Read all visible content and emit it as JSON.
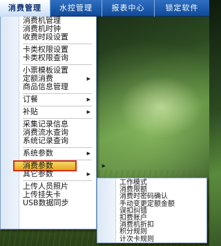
{
  "topbar": {
    "items": [
      "消费管理",
      "水控管理",
      "报表中心",
      "锁定软件"
    ]
  },
  "menu": {
    "group1": [
      "消费机管理",
      "消费机时钟",
      "收费时段设置"
    ],
    "group2": [
      "卡类权限设置",
      "卡类权限查询"
    ],
    "group3": [
      "小票模板设置",
      "定额消费",
      "商品信息管理"
    ],
    "group4": [
      "订餐",
      "补贴"
    ],
    "group5": [
      "采集记录信息",
      "消费流水查询",
      "系统记录查询",
      "系统参数"
    ],
    "highlighted": "消费参数",
    "group6": [
      "其它参数"
    ],
    "group7": [
      "上传人员照片",
      "上传挂失卡",
      "USB数据同步"
    ]
  },
  "submenu": {
    "items": [
      "工作模式",
      "消费限额",
      "消费时密码确认",
      "手动变更定额金额",
      "误扣纠错",
      "扣费账户",
      "消费机折扣",
      "积分规则",
      "计次卡规则"
    ]
  },
  "icons": {
    "submenu_arrow": "triangle-right-icon"
  }
}
